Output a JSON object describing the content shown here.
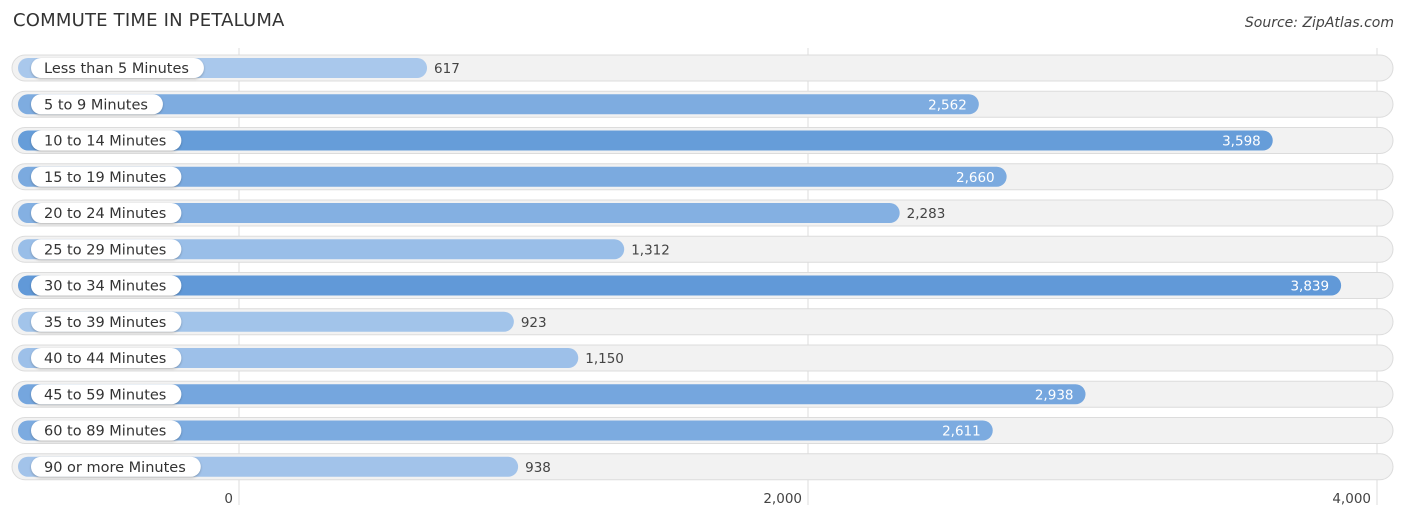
{
  "header": {
    "title": "COMMUTE TIME IN PETALUMA",
    "source": "Source: ZipAtlas.com"
  },
  "colors": {
    "bar_dark": "#6199d8",
    "bar_light": "#a9c8ec",
    "track": "#f2f2f2",
    "grid": "#dddddd"
  },
  "chart_data": {
    "type": "bar",
    "orientation": "horizontal",
    "title": "COMMUTE TIME IN PETALUMA",
    "xlabel": "",
    "ylabel": "",
    "categories": [
      "Less than 5 Minutes",
      "5 to 9 Minutes",
      "10 to 14 Minutes",
      "15 to 19 Minutes",
      "20 to 24 Minutes",
      "25 to 29 Minutes",
      "30 to 34 Minutes",
      "35 to 39 Minutes",
      "40 to 44 Minutes",
      "45 to 59 Minutes",
      "60 to 89 Minutes",
      "90 or more Minutes"
    ],
    "values": [
      617,
      2562,
      3598,
      2660,
      2283,
      1312,
      3839,
      923,
      1150,
      2938,
      2611,
      938
    ],
    "value_labels": [
      "617",
      "2,562",
      "3,598",
      "2,660",
      "2,283",
      "1,312",
      "3,839",
      "923",
      "1,150",
      "2,938",
      "2,611",
      "938"
    ],
    "xlim": [
      0,
      4000
    ],
    "xticks": [
      0,
      2000,
      4000
    ],
    "xtick_labels": [
      "0",
      "2,000",
      "4,000"
    ],
    "grid": true,
    "legend": "none"
  }
}
